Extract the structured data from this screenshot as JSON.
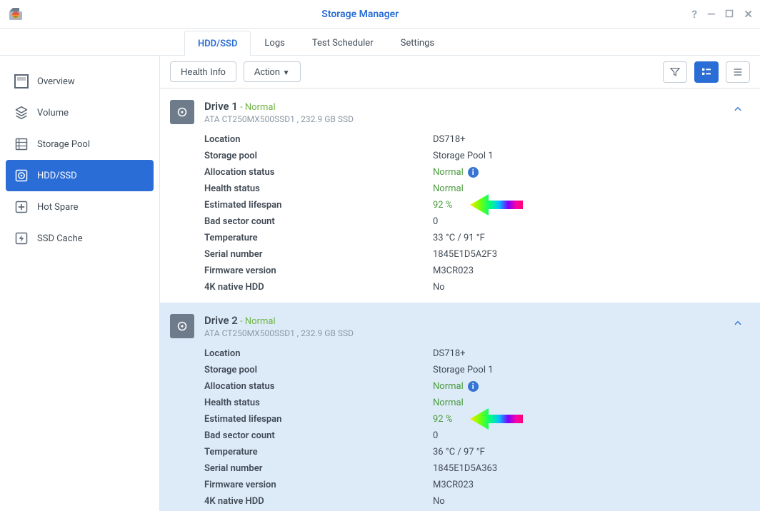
{
  "window": {
    "title": "Storage Manager"
  },
  "tabs": {
    "hdd_ssd": "HDD/SSD",
    "logs": "Logs",
    "test_scheduler": "Test Scheduler",
    "settings": "Settings"
  },
  "sidebar": {
    "overview": "Overview",
    "volume": "Volume",
    "storage_pool": "Storage Pool",
    "hdd_ssd": "HDD/SSD",
    "hot_spare": "Hot Spare",
    "ssd_cache": "SSD Cache"
  },
  "toolbar": {
    "health_info": "Health Info",
    "action": "Action"
  },
  "labels": {
    "location": "Location",
    "storage_pool": "Storage pool",
    "allocation_status": "Allocation status",
    "health_status": "Health status",
    "estimated_lifespan": "Estimated lifespan",
    "bad_sector_count": "Bad sector count",
    "temperature": "Temperature",
    "serial_number": "Serial number",
    "firmware_version": "Firmware version",
    "fourk_native": "4K native HDD",
    "status_sep": " - ",
    "info_badge": "i"
  },
  "drives": [
    {
      "name": "Drive 1",
      "status": "Normal",
      "sub": "ATA CT250MX500SSD1 , 232.9 GB SSD",
      "location": "DS718+",
      "storage_pool": "Storage Pool 1",
      "allocation_status": "Normal",
      "health_status": "Normal",
      "estimated_lifespan": "92 %",
      "bad_sector_count": "0",
      "temperature": "33 °C / 91 °F",
      "serial_number": "1845E1D5A2F3",
      "firmware_version": "M3CR023",
      "fourk_native": "No",
      "selected": false
    },
    {
      "name": "Drive 2",
      "status": "Normal",
      "sub": "ATA CT250MX500SSD1 , 232.9 GB SSD",
      "location": "DS718+",
      "storage_pool": "Storage Pool 1",
      "allocation_status": "Normal",
      "health_status": "Normal",
      "estimated_lifespan": "92 %",
      "bad_sector_count": "0",
      "temperature": "36 °C / 97 °F",
      "serial_number": "1845E1D5A363",
      "firmware_version": "M3CR023",
      "fourk_native": "No",
      "selected": true
    }
  ]
}
